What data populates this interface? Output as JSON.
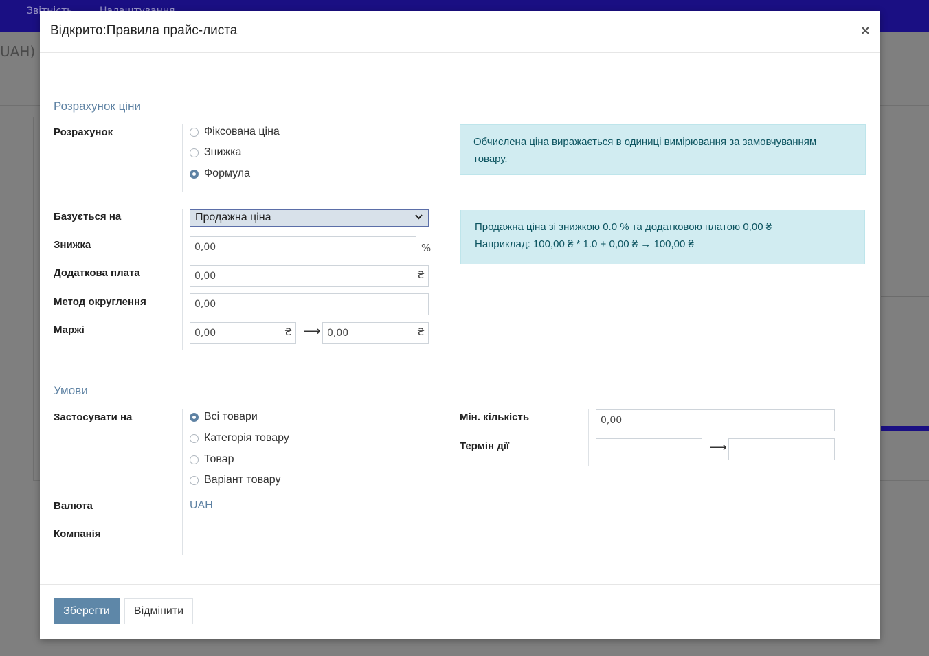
{
  "background": {
    "nav_items": [
      "Звітність",
      "Налаштування"
    ],
    "title_fragment": "UAH)"
  },
  "modal": {
    "title": "Відкрито:Правила прайс-листа",
    "close": "×"
  },
  "price_computation": {
    "section_title": "Розрахунок ціни",
    "compute_label": "Розрахунок",
    "options": [
      "Фіксована ціна",
      "Знижка",
      "Формула"
    ],
    "selected": "Формула",
    "info_text": "Обчислена ціна виражається в одиниці вимірювання за замовчуванням товару.",
    "based_on_label": "Базується на",
    "based_on_value": "Продажна ціна",
    "discount_label": "Знижка",
    "discount_value": "0,00",
    "discount_unit": "%",
    "surcharge_label": "Додаткова плата",
    "surcharge_value": "0,00",
    "currency_symbol": "₴",
    "rounding_label": "Метод округлення",
    "rounding_value": "0,00",
    "margins_label": "Маржі",
    "margin_min": "0,00",
    "margin_max": "0,00",
    "arrow": "⟶",
    "formula_line1": "Продажна ціна зі знижкою 0.0 % та додатковою платою 0,00 ₴",
    "formula_line2": "Наприклад: 100,00 ₴ * 1.0 + 0,00 ₴ → 100,00 ₴"
  },
  "conditions": {
    "section_title": "Умови",
    "apply_on_label": "Застосувати на",
    "apply_options": [
      "Всі товари",
      "Категорія товару",
      "Товар",
      "Варіант товару"
    ],
    "selected": "Всі товари",
    "currency_label": "Валюта",
    "currency_value": "UAH",
    "company_label": "Компанія",
    "min_qty_label": "Мін. кількість",
    "min_qty_value": "0,00",
    "validity_label": "Термін дії",
    "date_start": "",
    "date_end": ""
  },
  "footer": {
    "save": "Зберегти",
    "discard": "Відмінити"
  },
  "colors": {
    "primary": "#5e87a8",
    "section": "#5e82a3",
    "info_bg": "#d1ecf1",
    "navbar": "#1a0f83"
  }
}
